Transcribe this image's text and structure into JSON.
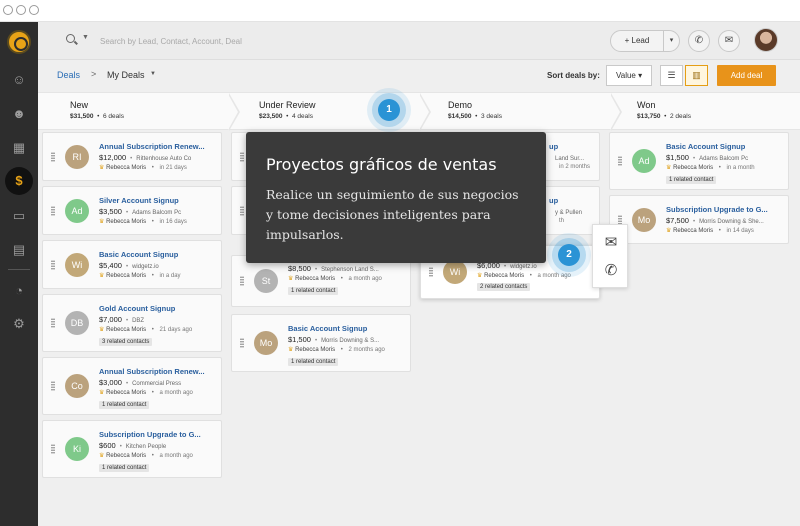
{
  "search": {
    "placeholder": "Search by Lead, Contact, Account, Deal"
  },
  "topbar": {
    "lead_label": "+ Lead"
  },
  "breadcrumb": {
    "root": "Deals",
    "separator": ">",
    "current": "My Deals"
  },
  "toolbar": {
    "sort_label": "Sort deals by:",
    "sort_value": "Value",
    "add_deal": "Add deal"
  },
  "icons": [
    "search-icon",
    "phone-icon",
    "mail-icon",
    "list-view-icon",
    "board-view-icon",
    "deals-icon",
    "contacts-icon",
    "accounts-icon",
    "chat-icon",
    "calendar-icon",
    "reports-icon",
    "settings-icon"
  ],
  "colors": {
    "accent": "#e8931a",
    "link": "#2a5f9e",
    "hotspot": "#2a93d5",
    "tooltip_bg": "#3a3a3a"
  },
  "stages": [
    {
      "name": "New",
      "amount": "$31,500",
      "count": "6 deals"
    },
    {
      "name": "Under Review",
      "amount": "$23,500",
      "count": "4 deals"
    },
    {
      "name": "Demo",
      "amount": "$14,500",
      "count": "3 deals"
    },
    {
      "name": "Won",
      "amount": "$13,750",
      "count": "2 deals"
    }
  ],
  "columns": [
    [
      {
        "initials": "RI",
        "color": "#bba27d",
        "title": "Annual Subscription Renew...",
        "value": "$12,000",
        "company": "Rittenhouse Auto Co",
        "owner": "Rebecca Moris",
        "when": "in 21 days",
        "tag": ""
      },
      {
        "initials": "Ad",
        "color": "#7fc98a",
        "title": "Silver Account Signup",
        "value": "$3,500",
        "company": "Adams Balcom Pc",
        "owner": "Rebecca Moris",
        "when": "in 16 days",
        "tag": ""
      },
      {
        "initials": "Wi",
        "color": "#c2a878",
        "title": "Basic Account Signup",
        "value": "$5,400",
        "company": "widgetz.io",
        "owner": "Rebecca Moris",
        "when": "in a day",
        "tag": ""
      },
      {
        "initials": "DB",
        "color": "#b3b3b3",
        "title": "Gold Account Signup",
        "value": "$7,000",
        "company": "DBZ",
        "owner": "Rebecca Moris",
        "when": "21 days ago",
        "tag": "3 related contacts"
      },
      {
        "initials": "Co",
        "color": "#bba27d",
        "title": "Annual Subscription Renew...",
        "value": "$3,000",
        "company": "Commercial Press",
        "owner": "Rebecca Moris",
        "when": "a month ago",
        "tag": "1 related contact"
      },
      {
        "initials": "Ki",
        "color": "#7fc98a",
        "title": "Subscription Upgrade to G...",
        "value": "$600",
        "company": "Kitchen People",
        "owner": "Rebecca Moris",
        "when": "a month ago",
        "tag": "1 related contact"
      }
    ],
    [
      {
        "initials": "St",
        "color": "#b3b3b3",
        "title": "",
        "value": "$8,500",
        "company": "Stephenson Land S...",
        "owner": "Rebecca Moris",
        "when": "a month ago",
        "tag": "1 related contact"
      },
      {
        "initials": "Mo",
        "color": "#bba27d",
        "title": "Basic Account Signup",
        "value": "$1,500",
        "company": "Morris Downing & S...",
        "owner": "Rebecca Moris",
        "when": "2 months ago",
        "tag": "1 related contact"
      }
    ],
    [
      {
        "initials": "Wi",
        "color": "#c2a878",
        "title": "",
        "value": "$6,000",
        "company": "widgetz.io",
        "owner": "Rebecca Moris",
        "when": "a month ago",
        "tag": "2 related contacts"
      }
    ],
    [
      {
        "initials": "Ad",
        "color": "#7fc98a",
        "title": "Basic Account Signup",
        "value": "$1,500",
        "company": "Adams Balcom Pc",
        "owner": "Rebecca Moris",
        "when": "in a month",
        "tag": "1 related contact"
      },
      {
        "initials": "Mo",
        "color": "#bba27d",
        "title": "Subscription Upgrade to G...",
        "value": "$7,500",
        "company": "Morris Downing & She...",
        "owner": "Rebecca Moris",
        "when": "in 14 days",
        "tag": ""
      }
    ]
  ],
  "partial_cards": {
    "c2_top": {
      "title": "...",
      "detail": ""
    },
    "c3_1": {
      "title": "up",
      "detail1": "Land Sur...",
      "detail2": "in 2 months"
    },
    "c3_2": {
      "title": "up",
      "detail1": "y & Pullen",
      "detail2": "th"
    }
  },
  "tooltip": {
    "title": "Proyectos gráficos de ventas",
    "body": "Realice un seguimiento de sus negocios y tome decisiones inteligentes para impulsarlos."
  },
  "hotspots": [
    "1",
    "2"
  ]
}
